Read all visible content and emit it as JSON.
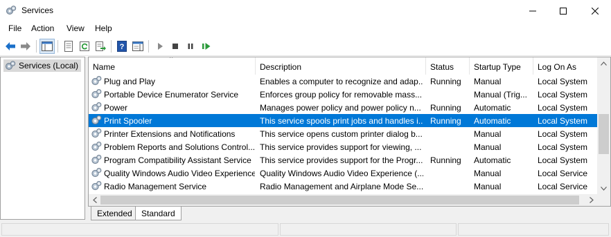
{
  "window": {
    "title": "Services"
  },
  "menu": [
    "File",
    "Action",
    "View",
    "Help"
  ],
  "toolbar": {
    "buttons": [
      "back-icon",
      "forward-icon",
      "show-hide-tree-icon",
      "properties-icon",
      "refresh-icon",
      "export-list-icon",
      "help-icon",
      "show-hide-action-pane-icon",
      "start-service-icon",
      "stop-service-icon",
      "pause-service-icon",
      "restart-service-icon"
    ]
  },
  "tree": {
    "root_label": "Services (Local)"
  },
  "columns": [
    "Name",
    "Description",
    "Status",
    "Startup Type",
    "Log On As"
  ],
  "rows": [
    {
      "name": "Plug and Play",
      "description": "Enables a computer to recognize and adap...",
      "status": "Running",
      "startup": "Manual",
      "logon": "Local System",
      "selected": false
    },
    {
      "name": "Portable Device Enumerator Service",
      "description": "Enforces group policy for removable mass...",
      "status": "",
      "startup": "Manual (Trig...",
      "logon": "Local System",
      "selected": false
    },
    {
      "name": "Power",
      "description": "Manages power policy and power policy n...",
      "status": "Running",
      "startup": "Automatic",
      "logon": "Local System",
      "selected": false
    },
    {
      "name": "Print Spooler",
      "description": "This service spools print jobs and handles i...",
      "status": "Running",
      "startup": "Automatic",
      "logon": "Local System",
      "selected": true
    },
    {
      "name": "Printer Extensions and Notifications",
      "description": "This service opens custom printer dialog b...",
      "status": "",
      "startup": "Manual",
      "logon": "Local System",
      "selected": false
    },
    {
      "name": "Problem Reports and Solutions Control...",
      "description": "This service provides support for viewing, ...",
      "status": "",
      "startup": "Manual",
      "logon": "Local System",
      "selected": false
    },
    {
      "name": "Program Compatibility Assistant Service",
      "description": "This service provides support for the Progr...",
      "status": "Running",
      "startup": "Automatic",
      "logon": "Local System",
      "selected": false
    },
    {
      "name": "Quality Windows Audio Video Experience",
      "description": "Quality Windows Audio Video Experience (...",
      "status": "",
      "startup": "Manual",
      "logon": "Local Service",
      "selected": false
    },
    {
      "name": "Radio Management Service",
      "description": "Radio Management and Airplane Mode Se...",
      "status": "",
      "startup": "Manual",
      "logon": "Local Service",
      "selected": false
    }
  ],
  "tabs": [
    {
      "label": "Extended",
      "active": false
    },
    {
      "label": "Standard",
      "active": true
    }
  ],
  "colors": {
    "selection": "#0078d7",
    "accent_blue": "#1a6fc9",
    "green": "#2b9a3a"
  }
}
